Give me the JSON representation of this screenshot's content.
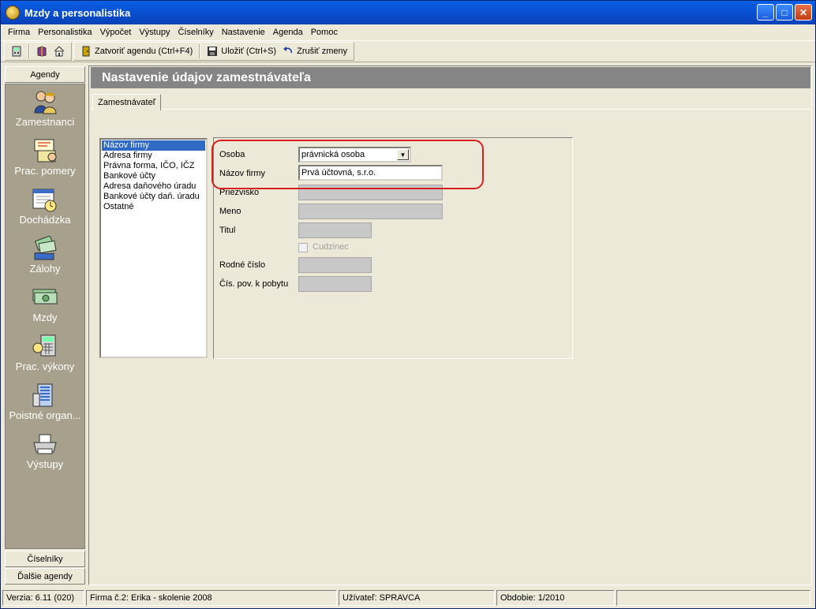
{
  "window": {
    "title": "Mzdy a personalistika"
  },
  "menu": [
    "Firma",
    "Personalistika",
    "Výpočet",
    "Výstupy",
    "Číselníky",
    "Nastavenie",
    "Agenda",
    "Pomoc"
  ],
  "toolbar": {
    "close_agenda": "Zatvoriť agendu (Ctrl+F4)",
    "save": "Uložiť (Ctrl+S)",
    "cancel": "Zrušiť zmeny"
  },
  "sidebar": {
    "header": "Agendy",
    "items": [
      {
        "label": "Zamestnanci",
        "icon": "people-icon"
      },
      {
        "label": "Prac. pomery",
        "icon": "org-chart-icon"
      },
      {
        "label": "Dochádzka",
        "icon": "calendar-clock-icon"
      },
      {
        "label": "Zálohy",
        "icon": "money-hand-icon"
      },
      {
        "label": "Mzdy",
        "icon": "banknotes-icon"
      },
      {
        "label": "Prac. výkony",
        "icon": "calculator-icon"
      },
      {
        "label": "Poistné organ...",
        "icon": "building-icon"
      },
      {
        "label": "Výstupy",
        "icon": "printer-icon"
      }
    ],
    "bottom1": "Číselníky",
    "bottom2": "Ďalšie agendy"
  },
  "main": {
    "header": "Nastavenie údajov zamestnávateľa",
    "tab": "Zamestnávateľ",
    "list_items": [
      "Názov firmy",
      "Adresa firmy",
      "Právna forma, IČO, IČZ",
      "Bankové účty",
      "Adresa daňového úradu",
      "Bankové účty daň. úradu",
      "Ostatné"
    ],
    "form": {
      "osoba_label": "Osoba",
      "osoba_value": "právnická osoba",
      "nazov_label": "Názov firmy",
      "nazov_value": "Prvá účtovná, s.r.o.",
      "priezvisko_label": "Priezvisko",
      "meno_label": "Meno",
      "titul_label": "Titul",
      "cudzinec_label": "Cudzinec",
      "rodne_label": "Rodné číslo",
      "cis_pov_label": "Čís. pov. k pobytu"
    }
  },
  "status": {
    "version": "Verzia: 6.11 (020)",
    "firma": "Firma č.2: Erika  - skolenie 2008",
    "user": "Užívateľ: SPRAVCA",
    "period": "Obdobie: 1/2010"
  },
  "colors": {
    "highlight": "#d61f1f",
    "selection": "#316ac5",
    "sidebar_bg": "#a6a08c",
    "header_bg": "#858585"
  }
}
